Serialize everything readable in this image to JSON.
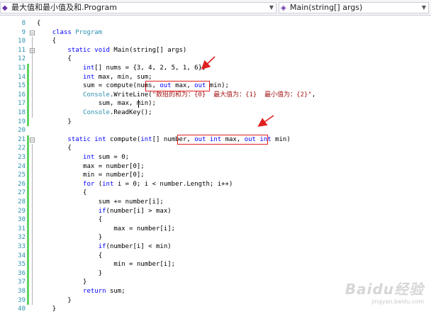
{
  "nav": {
    "class_selector": "最大值和最小值及和.Program",
    "member_selector": "Main(string[] args)"
  },
  "lines": [
    {
      "n": "8",
      "code": "{"
    },
    {
      "n": "9",
      "code": "    class Program"
    },
    {
      "n": "10",
      "code": "    {"
    },
    {
      "n": "11",
      "code": "        static void Main(string[] args)"
    },
    {
      "n": "12",
      "code": "        {"
    },
    {
      "n": "13",
      "code": "            int[] nums = {3, 4, 2, 5, 1, 6};"
    },
    {
      "n": "14",
      "code": "            int max, min, sum;"
    },
    {
      "n": "15",
      "code": "            sum = compute(nums, out max, out min);"
    },
    {
      "n": "16",
      "code": "            Console.WriteLine(\"数组的和为：{0}  最大值为：{1}  最小值为：{2}\","
    },
    {
      "n": "17",
      "code": "                sum, max, min);"
    },
    {
      "n": "18",
      "code": "            Console.ReadKey();"
    },
    {
      "n": "19",
      "code": "        }"
    },
    {
      "n": "20",
      "code": ""
    },
    {
      "n": "21",
      "code": "        static int compute(int[] number, out int max, out int min)"
    },
    {
      "n": "22",
      "code": "        {"
    },
    {
      "n": "23",
      "code": "            int sum = 0;"
    },
    {
      "n": "24",
      "code": "            max = number[0];"
    },
    {
      "n": "25",
      "code": "            min = number[0];"
    },
    {
      "n": "26",
      "code": "            for (int i = 0; i < number.Length; i++)"
    },
    {
      "n": "27",
      "code": "            {"
    },
    {
      "n": "28",
      "code": "                sum += number[i];"
    },
    {
      "n": "29",
      "code": "                if(number[i] > max)"
    },
    {
      "n": "30",
      "code": "                {"
    },
    {
      "n": "31",
      "code": "                    max = number[i];"
    },
    {
      "n": "32",
      "code": "                }"
    },
    {
      "n": "33",
      "code": "                if(number[i] < min)"
    },
    {
      "n": "34",
      "code": "                {"
    },
    {
      "n": "35",
      "code": "                    min = number[i];"
    },
    {
      "n": "36",
      "code": "                }"
    },
    {
      "n": "37",
      "code": "            }"
    },
    {
      "n": "38",
      "code": "            return sum;"
    },
    {
      "n": "39",
      "code": "        }"
    },
    {
      "n": "40",
      "code": "    }"
    }
  ],
  "watermark": {
    "brand": "Baidu经验",
    "url": "jingyan.baidu.com"
  },
  "colors": {
    "keyword": "#0000ff",
    "type": "#2b91af",
    "string": "#a31515",
    "line_number": "#2b91af",
    "highlight_box": "#e02020",
    "change_bar": "#5fd35f"
  },
  "icons": {
    "class_selector": "class-icon",
    "member_selector": "method-icon",
    "annotation": "red-arrow-icon"
  }
}
